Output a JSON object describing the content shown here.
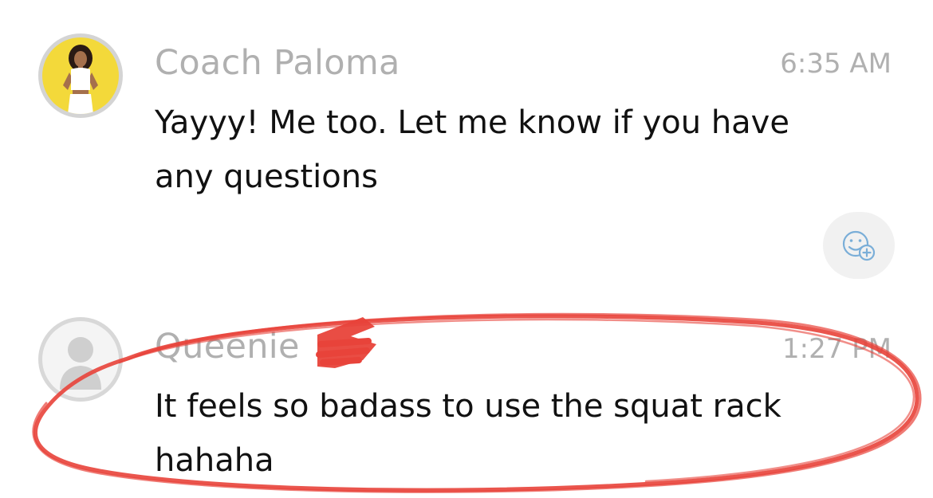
{
  "messages": [
    {
      "sender": "Coach Paloma",
      "time": "6:35 AM",
      "text_lines": [
        "Yayyy! Me too. Let me know if you have",
        "any questions"
      ],
      "avatar_icon": "profile-photo"
    },
    {
      "sender": "Queenie",
      "time": "1:27 PM",
      "text_lines": [
        "It feels so badass to use the squat rack",
        "hahaha"
      ],
      "avatar_icon": "default-user-silhouette"
    }
  ],
  "reaction": {
    "icon": "add-reaction-emoji-icon"
  },
  "colors": {
    "sender": "#b0b0b0",
    "text": "#111111",
    "annotation_red": "#e8433a",
    "coach_avatar_bg": "#f3d93a",
    "reaction_bg": "#f1f1f1",
    "reaction_icon": "#7aaed8"
  }
}
